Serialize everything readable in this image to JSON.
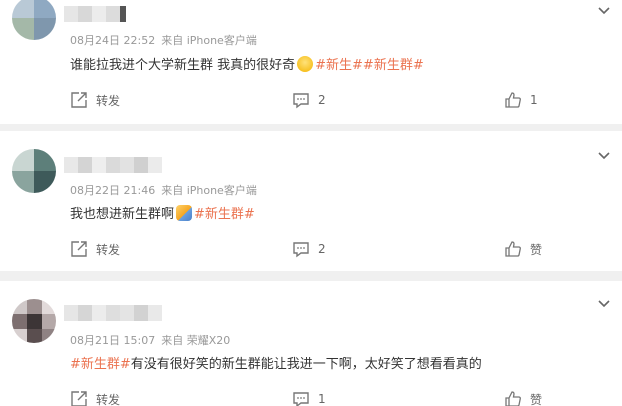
{
  "colors": {
    "tag": "#eb7350",
    "meta": "#999999",
    "text": "#333333",
    "divider": "#f0f0f0"
  },
  "comments": [
    {
      "date": "08月24日 22:52",
      "source": "来自 iPhone客户端",
      "text_before": "谁能拉我进个大学新生群 我真的很好奇",
      "emoji": "smile-emoji",
      "tags": "#新生##新生群#",
      "text_after": "",
      "share_label": "转发",
      "comment_count": "2",
      "like_label": "1"
    },
    {
      "date": "08月22日 21:46",
      "source": "来自 iPhone客户端",
      "text_before": "我也想进新生群啊",
      "emoji": "wave-emoji",
      "tags": "#新生群#",
      "text_after": "",
      "share_label": "转发",
      "comment_count": "2",
      "like_label": "赞"
    },
    {
      "date": "08月21日 15:07",
      "source": "来自 荣耀X20",
      "text_before": "",
      "emoji": "",
      "tags": "#新生群#",
      "text_after": "有没有很好笑的新生群能让我进一下啊，太好笑了想看看真的",
      "share_label": "转发",
      "comment_count": "1",
      "like_label": "赞"
    }
  ]
}
